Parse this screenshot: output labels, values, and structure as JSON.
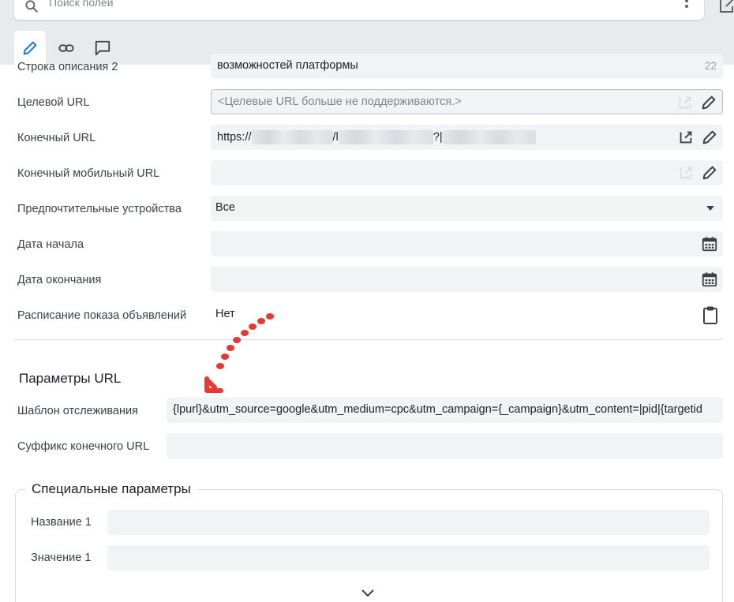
{
  "search": {
    "placeholder": "Поиск полей"
  },
  "tabs": [
    {
      "icon": "pencil-icon",
      "active": true
    },
    {
      "icon": "link-icon",
      "active": false
    },
    {
      "icon": "comment-icon",
      "active": false
    }
  ],
  "fields": {
    "description_line_2": {
      "label": "Строка описания 2",
      "value": "возможностей платформы",
      "char_count": "22"
    },
    "target_url": {
      "label": "Целевой URL",
      "placeholder": "<Целевые URL больше не поддерживаются.>"
    },
    "final_url": {
      "label": "Конечный URL",
      "prefix": "https://",
      "sep1": "/l",
      "sep2": "?|"
    },
    "final_mobile_url": {
      "label": "Конечный мобильный URL",
      "value": ""
    },
    "preferred_devices": {
      "label": "Предпочтительные устройства",
      "value": "Все"
    },
    "start_date": {
      "label": "Дата начала",
      "value": ""
    },
    "end_date": {
      "label": "Дата окончания",
      "value": ""
    },
    "ad_schedule": {
      "label": "Расписание показа объявлений",
      "value": "Нет"
    }
  },
  "url_params": {
    "title": "Параметры URL",
    "tracking_template": {
      "label": "Шаблон отслеживания",
      "value": "{lpurl}&utm_source=google&utm_medium=cpc&utm_campaign={_campaign}&utm_content=|pid|{targetid"
    },
    "final_url_suffix": {
      "label": "Суффикс конечного URL",
      "value": ""
    }
  },
  "custom_params": {
    "title": "Специальные параметры",
    "name_1": {
      "label": "Название 1",
      "value": ""
    },
    "value_1": {
      "label": "Значение 1",
      "value": ""
    }
  },
  "colors": {
    "annotation_arrow": "#e53935",
    "field_bg": "#f1f3f4",
    "header_bg": "#e8eaed",
    "accent": "#1a73e8"
  }
}
